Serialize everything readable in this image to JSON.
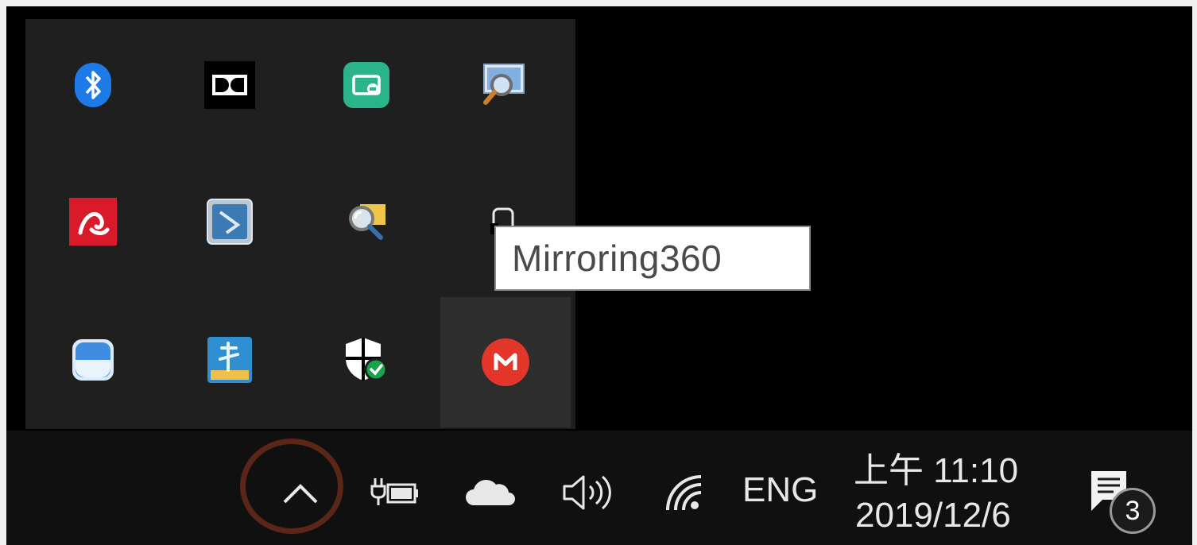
{
  "tray_icons": [
    {
      "name": "bluetooth-icon"
    },
    {
      "name": "dolby-icon"
    },
    {
      "name": "screen-share-icon"
    },
    {
      "name": "display-magnifier-icon"
    },
    {
      "name": "avira-antivirus-icon"
    },
    {
      "name": "app-tile-icon"
    },
    {
      "name": "search-tool-icon"
    },
    {
      "name": "mirroring360-small-icon"
    },
    {
      "name": "cloud-app-icon"
    },
    {
      "name": "pen-tablet-icon"
    },
    {
      "name": "windows-security-icon"
    },
    {
      "name": "mirroring360-icon"
    }
  ],
  "tooltip": {
    "text": "Mirroring360"
  },
  "taskbar": {
    "language": "ENG",
    "clock_time": "上午 11:10",
    "clock_date": "2019/12/6",
    "notification_count": "3"
  },
  "colors": {
    "flyout_bg": "#1f1f1f",
    "taskbar_bg": "#101010",
    "highlight_ring": "#5a2618",
    "bluetooth_blue": "#1e7ae6",
    "mirroring_red": "#e2362b"
  }
}
